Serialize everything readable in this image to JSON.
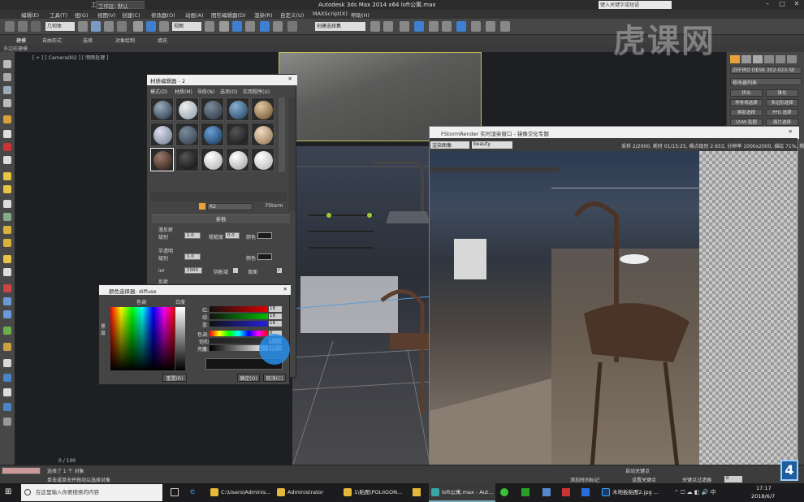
{
  "app": {
    "title": "Autodesk 3ds Max  2014 x64    loft公寓.max",
    "workspace_label": "工作区:",
    "workspace": "工作区: 默认",
    "search_placeholder": "键入关键字或短语"
  },
  "menu": [
    "编辑(E)",
    "工具(T)",
    "组(G)",
    "视图(V)",
    "创建(C)",
    "修改器(O)",
    "动画(A)",
    "图形编辑器(D)",
    "渲染(R)",
    "自定义(U)",
    "MAXScript(X)",
    "帮助(H)"
  ],
  "toolbar": {
    "selection_filter": "几何体",
    "view_dropdown": "视图",
    "named_set": "创建选择集"
  },
  "ribbon": {
    "tabs": [
      "建模",
      "自由形式",
      "选择",
      "对象绘制",
      "填充"
    ],
    "sub": "多边形建模"
  },
  "viewport": {
    "label": "[ + ] [ Camera002 ] [ 明暗处理 ]"
  },
  "right_panel": {
    "object_name": "ZEFIRO DESK 302-023-SE",
    "modifier_list": "修改器列表",
    "buttons": [
      "挤出",
      "锥化",
      "样条线选择",
      "多边形选择",
      "换影选择",
      "FFD 选择",
      "UVW 贴图",
      "面片选择"
    ]
  },
  "material_editor": {
    "title": "材质编辑器 - 2",
    "menu": [
      "模式(D)",
      "材质(M)",
      "导航(N)",
      "选项(O)",
      "实用程序(U)"
    ],
    "material_name": "R2",
    "renderer": "FStorm",
    "rollout": "参数",
    "sections": {
      "diffuse": "漫反射",
      "translucent": "半透明",
      "reflect": "反射"
    },
    "labels": {
      "level": "级别",
      "roughness": "粗糙度",
      "color": "颜色",
      "ior": "ior",
      "shadow_boost": "阴影域",
      "backface": "背面"
    },
    "values": {
      "diffuse_level": "1.0",
      "roughness": "0.0",
      "translucent_level": "1.0",
      "ior": "1000"
    }
  },
  "color_picker": {
    "title": "颜色选择器: diffuse",
    "hue_label": "色调",
    "white_label": "白度",
    "blackness_label": "黑度",
    "labels": [
      "红:",
      "绿:",
      "蓝:",
      "色调:",
      "饱和度:",
      "亮度:"
    ],
    "values": [
      "18",
      "18",
      "18",
      "0",
      "0",
      "18"
    ],
    "reset": "重置(R)",
    "ok": "确定(O)",
    "cancel": "取消(C)"
  },
  "fstorm": {
    "title": "FStormRender 实时渲染窗口 - 镜像交化专题",
    "channel": "渲染图像",
    "pass": "beauty",
    "status": "采样 2/2000, 耗时 01/15:25, 噪点级别 2.653, 分辨率 1000x2000, 描绘 71%, 剩余"
  },
  "status": {
    "selected": "选择了 1 个 对象",
    "hint": "单击或单击并拖动以选择对象",
    "frame": "0 / 100",
    "autokey": "自动关键点",
    "setkey": "设置关键点",
    "keyfilter": "关键点过滤器",
    "addtime": "添加时间标记",
    "frame_value": "0"
  },
  "taskbar": {
    "search": "在这里输入你要搜索的内容",
    "items": [
      "C:\\Users\\Adminis...",
      "Administrator",
      "1\\贴图\\POLIIGON...",
      "loft公寓.max - Aut...",
      "木地板贴图2.jpg ..."
    ],
    "time": "17:17",
    "date": "2018/6/7"
  },
  "watermark": "虎课网",
  "badge": "4"
}
